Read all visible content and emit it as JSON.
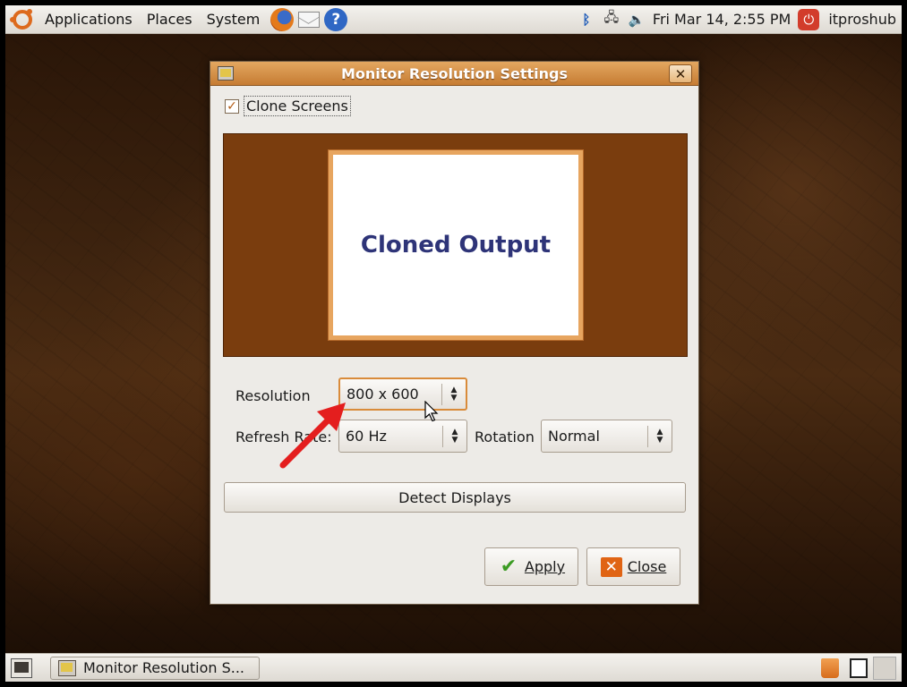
{
  "top_panel": {
    "menus": [
      "Applications",
      "Places",
      "System"
    ],
    "clock": "Fri Mar 14,  2:55 PM",
    "user": "itproshub"
  },
  "dialog": {
    "title": "Monitor Resolution Settings",
    "clone_screens": {
      "label": "Clone Screens",
      "checked": true
    },
    "preview_label": "Cloned Output",
    "resolution": {
      "label": "Resolution",
      "value": "800 x 600"
    },
    "refresh_rate": {
      "label": "Refresh Rate:",
      "value": "60 Hz"
    },
    "rotation": {
      "label": "Rotation",
      "value": "Normal"
    },
    "detect_button": "Detect Displays",
    "apply_button": "Apply",
    "close_button": "Close"
  },
  "taskbar": {
    "window_button": "Monitor Resolution S..."
  },
  "colors": {
    "titlebar": "#d48a44",
    "preview_bg": "#7a3d0e",
    "output_text": "#2e3478",
    "annotation_arrow": "#e41e1e"
  },
  "icons": [
    "ubuntu-logo",
    "firefox-icon",
    "mail-icon",
    "help-icon",
    "bluetooth-icon",
    "network-icon",
    "volume-icon",
    "power-icon",
    "monitor-icon",
    "close-icon",
    "checkmark-icon",
    "trash-icon"
  ]
}
